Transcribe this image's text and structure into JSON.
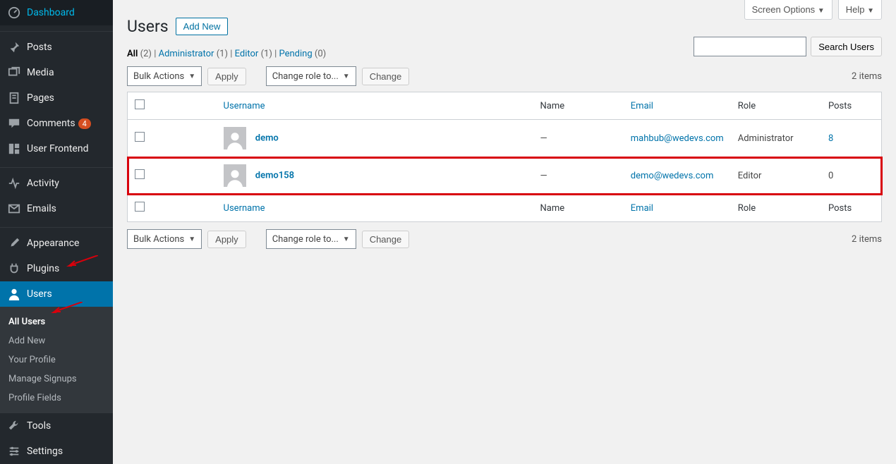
{
  "sidebar": {
    "items": [
      {
        "label": "Dashboard",
        "icon": "dash"
      },
      {
        "label": "Posts",
        "icon": "pin"
      },
      {
        "label": "Media",
        "icon": "media"
      },
      {
        "label": "Pages",
        "icon": "page"
      },
      {
        "label": "Comments",
        "icon": "comment",
        "badge": "4"
      },
      {
        "label": "User Frontend",
        "icon": "frontend"
      },
      {
        "label": "Activity",
        "icon": "activity"
      },
      {
        "label": "Emails",
        "icon": "envelope"
      },
      {
        "label": "Appearance",
        "icon": "brush"
      },
      {
        "label": "Plugins",
        "icon": "plug"
      },
      {
        "label": "Users",
        "icon": "user"
      },
      {
        "label": "Tools",
        "icon": "wrench"
      },
      {
        "label": "Settings",
        "icon": "sliders"
      }
    ],
    "submenu": [
      {
        "label": "All Users"
      },
      {
        "label": "Add New"
      },
      {
        "label": "Your Profile"
      },
      {
        "label": "Manage Signups"
      },
      {
        "label": "Profile Fields"
      }
    ]
  },
  "topbar": {
    "screen_options": "Screen Options",
    "help": "Help"
  },
  "page": {
    "title": "Users",
    "add_new": "Add New"
  },
  "filters": {
    "all": {
      "label": "All",
      "count": "(2)"
    },
    "admin": {
      "label": "Administrator",
      "count": "(1)"
    },
    "editor": {
      "label": "Editor",
      "count": "(1)"
    },
    "pending": {
      "label": "Pending",
      "count": "(0)"
    }
  },
  "toolbar": {
    "bulk": "Bulk Actions",
    "apply": "Apply",
    "change_role": "Change role to...",
    "change": "Change",
    "items": "2 items"
  },
  "search": {
    "button": "Search Users",
    "value": ""
  },
  "table": {
    "headers": {
      "username": "Username",
      "name": "Name",
      "email": "Email",
      "role": "Role",
      "posts": "Posts"
    },
    "rows": [
      {
        "username": "demo",
        "name": "—",
        "email": "mahbub@wedevs.com",
        "role": "Administrator",
        "posts": "8",
        "highlight": false
      },
      {
        "username": "demo158",
        "name": "—",
        "email": "demo@wedevs.com",
        "role": "Editor",
        "posts": "0",
        "highlight": true
      }
    ]
  }
}
